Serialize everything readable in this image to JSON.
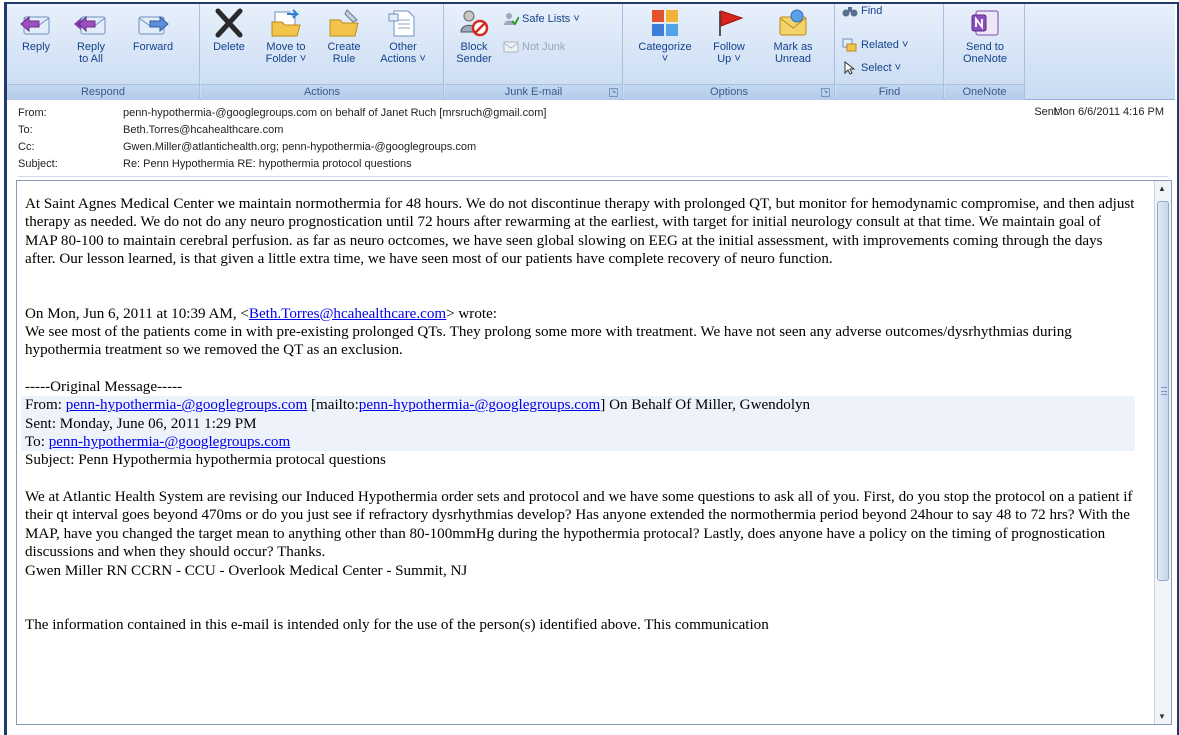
{
  "ribbon": {
    "respond": {
      "label": "Respond",
      "reply": "Reply",
      "reply_all": "Reply\nto All",
      "forward": "Forward"
    },
    "actions": {
      "label": "Actions",
      "delete": "Delete",
      "move_to_folder": "Move to\nFolder ˅",
      "create_rule": "Create\nRule",
      "other_actions": "Other\nActions ˅"
    },
    "junk": {
      "label": "Junk E-mail",
      "block_sender": "Block\nSender",
      "safe_lists": "Safe Lists ˅",
      "not_junk": "Not Junk"
    },
    "options": {
      "label": "Options",
      "categorize": "Categorize\n˅",
      "follow_up": "Follow\nUp ˅",
      "mark_as_unread": "Mark as\nUnread"
    },
    "find": {
      "label": "Find",
      "find": "Find",
      "related": "Related ˅",
      "select": "Select ˅"
    },
    "onenote": {
      "label": "OneNote",
      "send_to_onenote": "Send to\nOneNote"
    }
  },
  "header": {
    "from_label": "From:",
    "from_value": "penn-hypothermia-@googlegroups.com on behalf of Janet Ruch [mrsruch@gmail.com]",
    "to_label": "To:",
    "to_value": "Beth.Torres@hcahealthcare.com",
    "cc_label": "Cc:",
    "cc_value": "Gwen.Miller@atlantichealth.org; penn-hypothermia-@googlegroups.com",
    "subject_label": "Subject:",
    "subject_value": "Re: Penn Hypothermia RE: hypothermia protocol questions",
    "sent_label": "Sent:",
    "sent_value": "Mon 6/6/2011 4:16 PM"
  },
  "body": {
    "para1": "At Saint Agnes Medical Center we maintain normothermia for 48 hours. We do not discontinue therapy with prolonged QT, but monitor for hemodynamic compromise, and then adjust therapy as needed. We do not do any neuro prognostication until 72 hours after rewarming at the earliest, with target for initial neurology consult at that time. We maintain goal of MAP 80-100 to maintain cerebral perfusion. as far as neuro octcomes, we have seen global slowing on EEG at the initial assessment, with improvements coming through the days after. Our lesson learned, is that given a little extra time, we have seen most of our patients have complete recovery of neuro function.",
    "reply_intro_before": "On Mon, Jun 6, 2011 at 10:39 AM, <",
    "reply_intro_link": "Beth.Torres@hcahealthcare.com",
    "reply_intro_after": "> wrote:",
    "reply_text": "We see most of the patients come in with pre-existing prolonged QTs.  They prolong some more with treatment. We have not seen any adverse outcomes/dysrhythmias during hypothermia treatment so we removed the QT as an exclusion.",
    "original_marker": "-----Original Message-----",
    "orig_from_prefix": "From: ",
    "orig_from_link": "penn-hypothermia-@googlegroups.com",
    "orig_from_mid": " [mailto:",
    "orig_from_link2": "penn-hypothermia-@googlegroups.com",
    "orig_from_suffix": "] On Behalf Of Miller, Gwendolyn",
    "orig_sent": "Sent: Monday, June 06, 2011 1:29 PM",
    "orig_to_prefix": "To: ",
    "orig_to_link": "penn-hypothermia-@googlegroups.com",
    "orig_subject": "Subject: Penn Hypothermia hypothermia protocal questions",
    "orig_body": "We at Atlantic Health System are revising our Induced Hypothermia order sets and protocol and we have some questions to ask all of you.  First, do you stop the protocol on a patient if their qt interval goes beyond 470ms or do you just see if refractory dysrhythmias develop?  Has anyone extended the normothermia period beyond 24hour to say 48 to 72 hrs?   With the MAP, have you changed the target mean to anything other than 80-100mmHg during the hypothermia protocal?  Lastly, does anyone have a policy on the timing of prognostication discussions and when they should occur?  Thanks.",
    "signature": "Gwen Miller RN CCRN - CCU - Overlook Medical Center - Summit, NJ",
    "cut_text": "The information contained in this e-mail is intended only for the use of the person(s) identified above. This communication"
  },
  "colors": {
    "ribbon_bg": "#d6e4f6",
    "ribbon_text": "#15428b",
    "link": "#0000ee",
    "frame": "#1f3a6d"
  }
}
